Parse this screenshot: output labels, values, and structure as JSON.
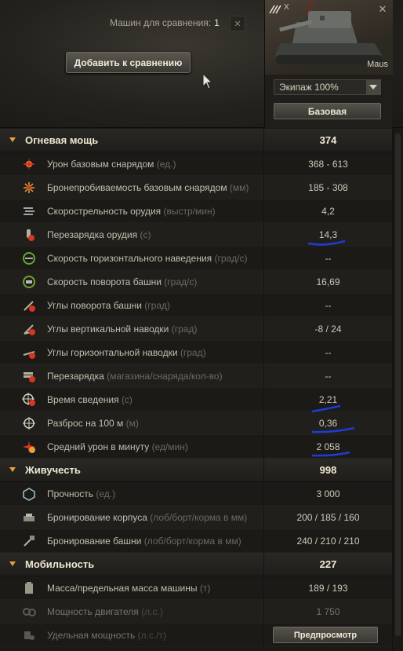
{
  "header": {
    "compare_label": "Машин для сравнения:",
    "compare_count": "1",
    "clear_symbol": "✕",
    "add_button": "Добавить к сравнению"
  },
  "vehicle": {
    "tier": "X",
    "name": "Maus",
    "crew": "Экипаж 100%",
    "base_button": "Базовая",
    "close_symbol": "✕"
  },
  "sections": [
    {
      "title": "Огневая мощь",
      "total": "374",
      "rows": [
        {
          "icon": "damage-icon",
          "label": "Урон базовым снарядом",
          "unit": "(ед.)",
          "value": "368 - 613"
        },
        {
          "icon": "penetration-icon",
          "label": "Бронепробиваемость базовым снарядом",
          "unit": "(мм)",
          "value": "185 - 308"
        },
        {
          "icon": "rate-of-fire-icon",
          "label": "Скорострельность орудия",
          "unit": "(выстр/мин)",
          "value": "4,2"
        },
        {
          "icon": "reload-icon",
          "label": "Перезарядка орудия",
          "unit": "(с)",
          "value": "14,3"
        },
        {
          "icon": "traverse-speed-icon",
          "label": "Скорость горизонтального наведения",
          "unit": "(град/с)",
          "value": "--"
        },
        {
          "icon": "turret-speed-icon",
          "label": "Скорость поворота башни",
          "unit": "(град/с)",
          "value": "16,69"
        },
        {
          "icon": "turret-angles-icon",
          "label": "Углы поворота башни",
          "unit": "(град)",
          "value": "--"
        },
        {
          "icon": "vertical-angles-icon",
          "label": "Углы вертикальной наводки",
          "unit": "(град)",
          "value": "-8 / 24"
        },
        {
          "icon": "horizontal-angles-icon",
          "label": "Углы горизонтальной наводки",
          "unit": "(град)",
          "value": "--"
        },
        {
          "icon": "magazine-reload-icon",
          "label": "Перезарядка",
          "unit": "(магазина/снаряда/кол-во)",
          "value": "--"
        },
        {
          "icon": "aim-time-icon",
          "label": "Время сведения",
          "unit": "(с)",
          "value": "2,21"
        },
        {
          "icon": "dispersion-icon",
          "label": "Разброс на 100 м",
          "unit": "(м)",
          "value": "0,36"
        },
        {
          "icon": "dpm-icon",
          "label": "Средний урон в минуту",
          "unit": "(ед/мин)",
          "value": "2 058"
        }
      ]
    },
    {
      "title": "Живучесть",
      "total": "998",
      "rows": [
        {
          "icon": "hitpoints-icon",
          "label": "Прочность",
          "unit": "(ед.)",
          "value": "3 000"
        },
        {
          "icon": "hull-armor-icon",
          "label": "Бронирование корпуса",
          "unit": "(лоб/борт/корма в мм)",
          "value": "200 / 185 / 160"
        },
        {
          "icon": "turret-armor-icon",
          "label": "Бронирование башни",
          "unit": "(лоб/борт/корма в мм)",
          "value": "240 / 210 / 210"
        }
      ]
    },
    {
      "title": "Мобильность",
      "total": "227",
      "rows": [
        {
          "icon": "weight-icon",
          "label": "Масса/предельная масса машины",
          "unit": "(т)",
          "value": "189 / 193"
        },
        {
          "icon": "engine-power-icon",
          "label": "Мощность двигателя",
          "unit": "(л.с.)",
          "value": "1 750"
        },
        {
          "icon": "specific-power-icon",
          "label": "Удельная мощность",
          "unit": "(л.с./т)",
          "value": ""
        }
      ]
    }
  ],
  "footer": {
    "preview_button": "Предпросмотр"
  },
  "colors": {
    "accent_orange": "#e9a13a",
    "annotation_blue": "#1f3bd6",
    "red_icon": "#d8361f"
  }
}
